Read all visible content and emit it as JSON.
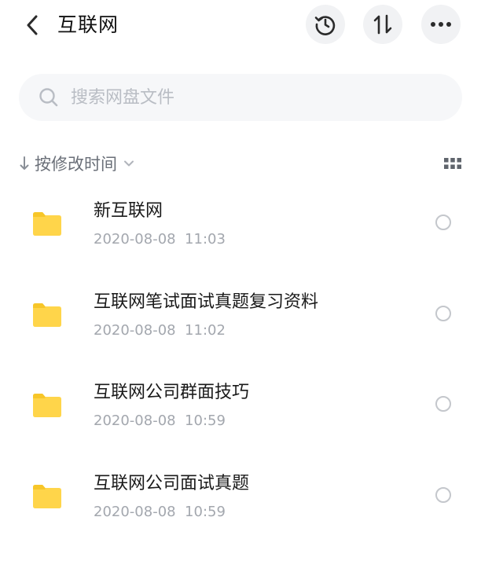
{
  "header": {
    "title": "互联网",
    "icons": {
      "back": "chevron-left-icon",
      "history": "history-clock-icon",
      "sort": "sort-arrows-icon",
      "more": "more-dots-icon"
    }
  },
  "search": {
    "placeholder": "搜索网盘文件",
    "icon": "search-icon"
  },
  "sort": {
    "label": "按修改时间",
    "direction_icon": "arrow-down-icon",
    "dropdown_icon": "chevron-down-icon",
    "view_icon": "grid-view-icon"
  },
  "files": [
    {
      "name": "新互联网",
      "date": "2020-08-08  11:03",
      "type": "folder"
    },
    {
      "name": "互联网笔试面试真题复习资料",
      "date": "2020-08-08  11:02",
      "type": "folder"
    },
    {
      "name": "互联网公司群面技巧",
      "date": "2020-08-08  10:59",
      "type": "folder"
    },
    {
      "name": "互联网公司面试真题",
      "date": "2020-08-08  10:59",
      "type": "folder"
    }
  ],
  "colors": {
    "folder": "#ffd54a",
    "folder_tab": "#f7c629",
    "icon_dark": "#2b2b2b",
    "muted_text": "#a3a7ae",
    "button_bg": "#f1f2f4"
  }
}
